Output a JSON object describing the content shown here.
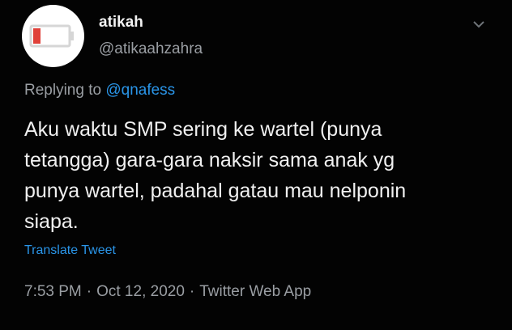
{
  "user": {
    "display_name": "atikah",
    "handle": "@atikaahzahra",
    "avatar_icon": "low-battery-icon"
  },
  "menu": {
    "icon": "chevron-down-icon"
  },
  "reply": {
    "prefix": "Replying to",
    "mention": "@qnafess"
  },
  "tweet": {
    "lines": [
      "Aku waktu SMP sering ke wartel (punya",
      "tetangga) gara-gara naksir sama anak yg",
      "punya wartel, padahal gatau mau nelponin",
      "siapa."
    ]
  },
  "translate_label": "Translate Tweet",
  "meta": {
    "time": "7:53 PM",
    "separator": "·",
    "date": "Oct 12, 2020",
    "source": "Twitter Web App"
  },
  "colors": {
    "background": "#030303",
    "link": "#2a95e8",
    "secondary_text": "#9a9ea3",
    "battery_red": "#e0413a"
  }
}
